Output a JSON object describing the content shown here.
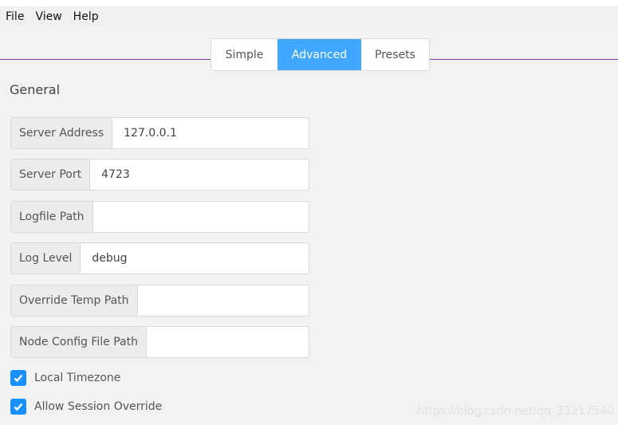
{
  "menu": [
    "File",
    "View",
    "Help"
  ],
  "tabs": [
    {
      "label": "Simple",
      "active": false
    },
    {
      "label": "Advanced",
      "active": true
    },
    {
      "label": "Presets",
      "active": false
    }
  ],
  "section_title": "General",
  "fields": [
    {
      "label": "Server Address",
      "value": "127.0.0.1"
    },
    {
      "label": "Server Port",
      "value": "4723"
    },
    {
      "label": "Logfile Path",
      "value": ""
    },
    {
      "label": "Log Level",
      "value": "debug"
    },
    {
      "label": "Override Temp Path",
      "value": ""
    },
    {
      "label": "Node Config File Path",
      "value": ""
    }
  ],
  "checkboxes": [
    {
      "label": "Local Timezone",
      "checked": true
    },
    {
      "label": "Allow Session Override",
      "checked": true
    }
  ],
  "watermark": "https://blog.csdn.net/qq_33217540",
  "colors": {
    "accent": "#40a9ff",
    "checkbox": "#1890ff",
    "divider": "#7b3aa3"
  }
}
